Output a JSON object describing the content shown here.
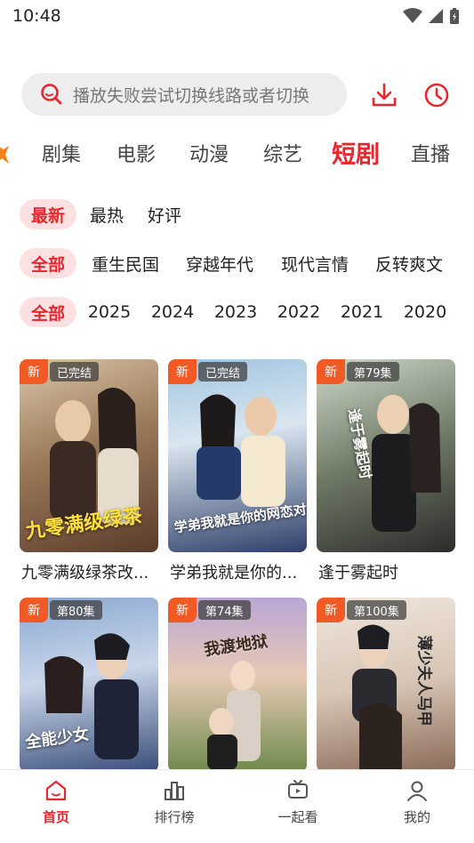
{
  "status_bar": {
    "time": "10:48"
  },
  "search": {
    "placeholder": "播放失败尝试切换线路或者切换"
  },
  "colors": {
    "accent": "#e8262d",
    "new_badge": "#f15a24",
    "chip_active_bg": "#fde1e2"
  },
  "category_tabs": [
    {
      "label": "剧集",
      "active": false
    },
    {
      "label": "电影",
      "active": false
    },
    {
      "label": "动漫",
      "active": false
    },
    {
      "label": "综艺",
      "active": false
    },
    {
      "label": "短剧",
      "active": true
    },
    {
      "label": "直播",
      "active": false
    }
  ],
  "filters": {
    "sort": [
      "最新",
      "最热",
      "好评"
    ],
    "genre": [
      "全部",
      "重生民国",
      "穿越年代",
      "现代言情",
      "反转爽文"
    ],
    "year": [
      "全部",
      "2025",
      "2024",
      "2023",
      "2022",
      "2021",
      "2020"
    ]
  },
  "cards": [
    {
      "title": "九零满级绿茶改...",
      "badge_new": "新",
      "status": "已完结",
      "poster_text": "九零满级绿茶"
    },
    {
      "title": "学弟我就是你的...",
      "badge_new": "新",
      "status": "已完结",
      "poster_text": "学弟我就是你的网恋对象啊"
    },
    {
      "title": "逢于雾起时",
      "badge_new": "新",
      "status": "第79集",
      "poster_text": "逢于雾起时"
    },
    {
      "title": "",
      "badge_new": "新",
      "status": "第80集",
      "poster_text": "全能少女"
    },
    {
      "title": "",
      "badge_new": "新",
      "status": "第74集",
      "poster_text": "我渡地狱"
    },
    {
      "title": "",
      "badge_new": "新",
      "status": "第100集",
      "poster_text": "薄少夫人马甲"
    }
  ],
  "bottom_nav": [
    {
      "label": "首页",
      "icon": "home-icon",
      "active": true
    },
    {
      "label": "排行榜",
      "icon": "ranking-icon",
      "active": false
    },
    {
      "label": "一起看",
      "icon": "tv-icon",
      "active": false
    },
    {
      "label": "我的",
      "icon": "profile-icon",
      "active": false
    }
  ]
}
